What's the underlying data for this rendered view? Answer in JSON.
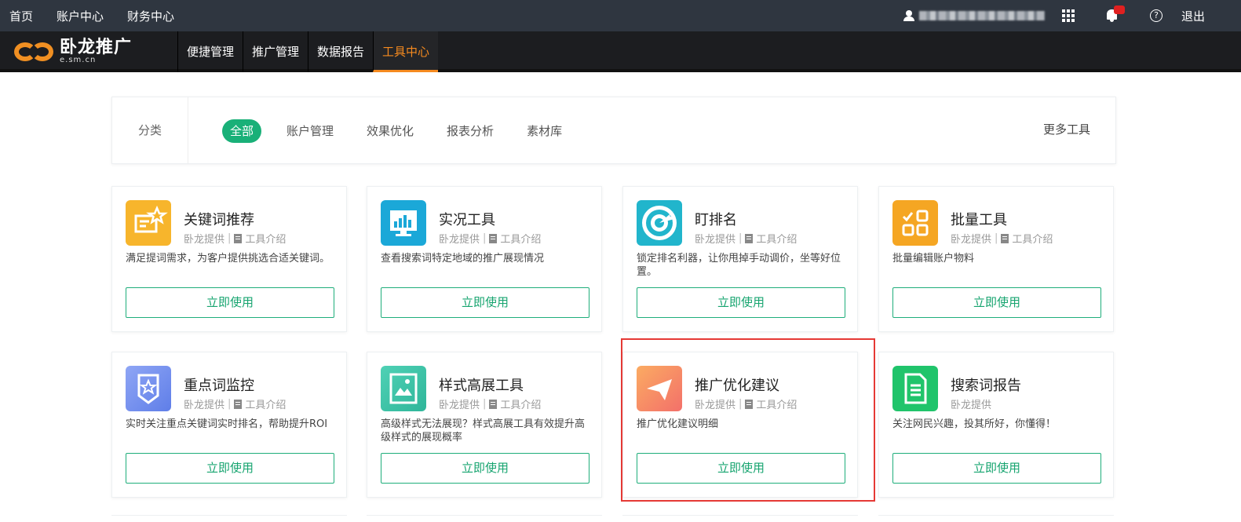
{
  "topbar": {
    "links": [
      "首页",
      "账户中心",
      "财务中心"
    ],
    "logout_label": "退出",
    "help_label": "?"
  },
  "navbar": {
    "logo_cn": "卧龙推广",
    "logo_en": "e.sm.cn",
    "items": [
      "便捷管理",
      "推广管理",
      "数据报告",
      "工具中心"
    ],
    "active": "工具中心"
  },
  "categories": {
    "label": "分类",
    "items": [
      "全部",
      "账户管理",
      "效果优化",
      "报表分析",
      "素材库"
    ],
    "active": "全部",
    "more_label": "更多工具"
  },
  "cards": [
    {
      "title": "关键词推荐",
      "provider": "卧龙提供",
      "intro": "工具介绍",
      "desc": "满足提词需求，为客户提供挑选合适关键词。",
      "button": "立即使用",
      "icon": "keyword-star-icon",
      "color": "#f7b52c"
    },
    {
      "title": "实况工具",
      "provider": "卧龙提供",
      "intro": "工具介绍",
      "desc": "查看搜索词特定地域的推广展现情况",
      "button": "立即使用",
      "icon": "monitor-chart-icon",
      "color": "#1ba8d8"
    },
    {
      "title": "盯排名",
      "provider": "卧龙提供",
      "intro": "工具介绍",
      "desc": "锁定排名利器，让你甩掉手动调价，坐等好位置。",
      "button": "立即使用",
      "icon": "target-arrow-icon",
      "color": "#21b5cc"
    },
    {
      "title": "批量工具",
      "provider": "卧龙提供",
      "intro": "工具介绍",
      "desc": "批量编辑账户物料",
      "button": "立即使用",
      "icon": "batch-grid-icon",
      "color": "#f5a623"
    },
    {
      "title": "重点词监控",
      "provider": "卧龙提供",
      "intro": "工具介绍",
      "desc": "实时关注重点关键词实时排名，帮助提升ROI",
      "button": "立即使用",
      "icon": "star-badge-icon",
      "color": "#6f8ef0"
    },
    {
      "title": "样式高展工具",
      "provider": "卧龙提供",
      "intro": "工具介绍",
      "desc": "高级样式无法展现？样式高展工具有效提升高级样式的展现概率",
      "button": "立即使用",
      "icon": "image-frame-icon",
      "color": "#3cc6a8"
    },
    {
      "title": "推广优化建议",
      "provider": "卧龙提供",
      "intro": "工具介绍",
      "desc": "推广优化建议明细",
      "button": "立即使用",
      "icon": "paper-plane-icon",
      "color": "#f7875f"
    },
    {
      "title": "搜索词报告",
      "provider": "卧龙提供",
      "intro": "",
      "desc": "关注网民兴趣，投其所好，你懂得！",
      "button": "立即使用",
      "icon": "document-report-icon",
      "color": "#20c46b"
    }
  ]
}
